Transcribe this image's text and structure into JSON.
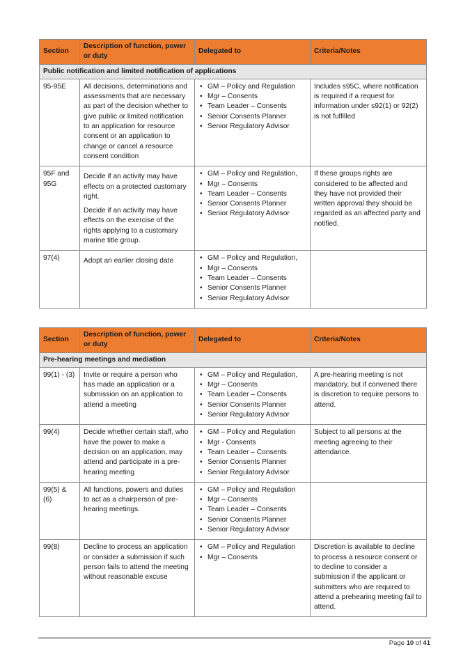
{
  "tables": [
    {
      "headers": {
        "section": "Section",
        "description": "Description of function, power or duty",
        "delegated_to": "Delegated to",
        "criteria": "Criteria/Notes"
      },
      "group_title": "Public notification and limited notification of applications",
      "rows": [
        {
          "section": "95-95E",
          "description": [
            "All decisions, determinations and assessments that are necessary as part of the decision whether to give public or limited notification to an application for resource consent or an application to change or cancel a resource consent condition"
          ],
          "delegated_to": [
            "GM – Policy and Regulation",
            "Mgr – Consents",
            "Team Leader – Consents",
            "Senior Consents Planner",
            "Senior Regulatory Advisor"
          ],
          "criteria": "Includes s95C, where notification is required if a request for information under s92(1) or 92(2) is not fulfilled"
        },
        {
          "section": "95F and 95G",
          "description": [
            "Decide if an activity may have effects on a protected customary right.",
            "Decide if an activity may have effects on the exercise of the rights applying to a customary marine title group."
          ],
          "delegated_to": [
            "GM – Policy and Regulation,",
            "Mgr – Consents",
            "Team Leader – Consents",
            "Senior Consents Planner",
            "Senior Regulatory Advisor"
          ],
          "criteria": "If these groups rights are considered to be affected and they have not provided their written approval they should be regarded as an affected party and notified."
        },
        {
          "section": "97(4)",
          "description": [
            "Adopt an earlier closing date"
          ],
          "delegated_to": [
            "GM – Policy and Regulation,",
            "Mgr – Consents",
            "Team Leader – Consents",
            "Senior Consents Planner",
            "Senior Regulatory Advisor"
          ],
          "criteria": ""
        }
      ]
    },
    {
      "headers": {
        "section": "Section",
        "description": "Description of function, power or duty",
        "delegated_to": "Delegated to",
        "criteria": "Criteria/Notes"
      },
      "group_title": "Pre-hearing meetings and mediation",
      "rows": [
        {
          "section": "99(1) - (3)",
          "description": [
            "Invite or require a person who has made an application or a submission on an application to attend a meeting"
          ],
          "delegated_to": [
            "GM – Policy and Regulation,",
            "Mgr – Consents",
            "Team Leader – Consents",
            "Senior Consents Planner",
            "Senior Regulatory Advisor"
          ],
          "criteria": "A pre-hearing meeting is not mandatory, but if convened there is discretion to require persons to attend."
        },
        {
          "section": "99(4)",
          "description": [
            "Decide whether certain staff, who have the power to make a decision on an application, may attend and participate in a pre-hearing meeting"
          ],
          "delegated_to": [
            "GM – Policy and Regulation",
            "Mgr - Consents",
            "Team Leader – Consents",
            "Senior Consents Planner",
            "Senior Regulatory Advisor"
          ],
          "criteria": "Subject to all persons at the meeting agreeing to their attendance."
        },
        {
          "section": "99(5) & (6)",
          "description": [
            "All functions, powers and duties to act as a chairperson of pre-hearing meetings."
          ],
          "delegated_to": [
            "GM – Policy and Regulation",
            "Mgr – Consents",
            "Team Leader – Consents",
            "Senior Consents Planner",
            "Senior Regulatory Advisor"
          ],
          "criteria": ""
        },
        {
          "section": "99(8)",
          "description": [
            "Decline to process an application or consider a submission if such person fails to attend the meeting without reasonable excuse"
          ],
          "delegated_to": [
            "GM – Policy and Regulation",
            "Mgr – Consents"
          ],
          "criteria": "Discretion is available to decline to process a resource consent or to decline to consider a submission if the applicant or submitters who are required to attend a prehearing meeting fail to attend."
        }
      ]
    }
  ],
  "footer": {
    "page_label": "Page",
    "page_current": "10",
    "page_of": "of",
    "page_total": "41"
  }
}
